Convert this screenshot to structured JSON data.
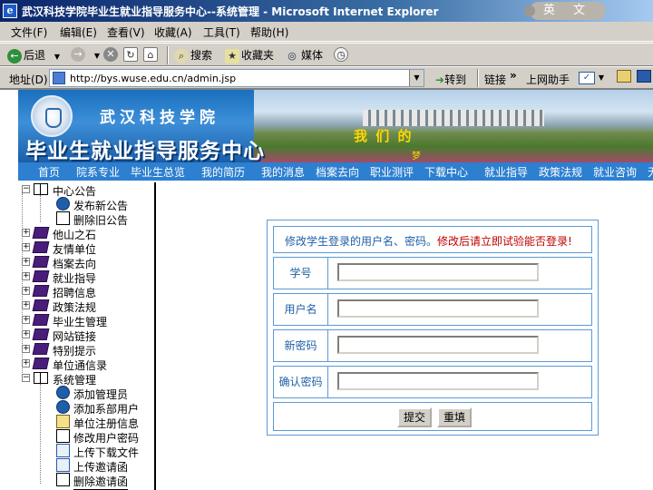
{
  "window": {
    "title": "武汉科技学院毕业生就业指导服务中心--系统管理 - Microsoft Internet Explorer",
    "lang_indicator": "英 文"
  },
  "menu": [
    "文件(F)",
    "编辑(E)",
    "查看(V)",
    "收藏(A)",
    "工具(T)",
    "帮助(H)"
  ],
  "toolbar": {
    "back": "后退",
    "search": "搜索",
    "favorites": "收藏夹",
    "media": "媒体"
  },
  "address": {
    "label": "地址(D)",
    "url": "http://bys.wuse.edu.cn/admin.jsp",
    "go": "转到",
    "links": "链接",
    "chevron": "»",
    "helper": "上网助手"
  },
  "banner": {
    "university": "武汉科技学院",
    "center": "毕业生就业指导服务中心",
    "slogan": "我 们 的",
    "dream": "梦"
  },
  "nav": [
    "首页",
    "院系专业",
    "毕业生总览",
    "我的简历",
    "我的消息",
    "档案去向",
    "职业测评",
    "下载中心",
    "就业指导",
    "政策法规",
    "就业咨询",
    "无"
  ],
  "tree": {
    "groups": [
      {
        "label": "中心公告",
        "expanded": true
      },
      {
        "label": "他山之石"
      },
      {
        "label": "友情单位"
      },
      {
        "label": "档案去向"
      },
      {
        "label": "就业指导"
      },
      {
        "label": "招聘信息"
      },
      {
        "label": "政策法规"
      },
      {
        "label": "毕业生管理"
      },
      {
        "label": "网站链接"
      },
      {
        "label": "特别提示"
      },
      {
        "label": "单位通信录"
      },
      {
        "label": "系统管理",
        "expanded": true
      }
    ],
    "notice_children": [
      "发布新公告",
      "删除旧公告"
    ],
    "admin_children": [
      "添加管理员",
      "添加系部用户",
      "单位注册信息",
      "修改用户密码",
      "上传下载文件",
      "上传邀请函",
      "删除邀请函"
    ]
  },
  "form": {
    "header": "修改学生登录的用户名、密码。",
    "warning": "修改后请立即试验能否登录!",
    "fields": [
      {
        "label": "学号",
        "value": ""
      },
      {
        "label": "用户名",
        "value": ""
      },
      {
        "label": "新密码",
        "value": ""
      },
      {
        "label": "确认密码",
        "value": ""
      }
    ],
    "submit": "提交",
    "reset": "重填"
  },
  "colors": {
    "nav_bg": "#2d7fd0",
    "form_border": "#5b9ad6",
    "form_text": "#1f5fa8",
    "warning": "#c00000"
  }
}
